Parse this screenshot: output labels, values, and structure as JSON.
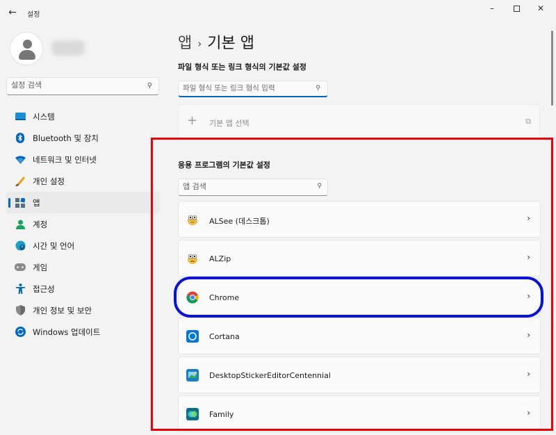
{
  "window": {
    "title": "설정",
    "back_icon": "←",
    "minimize_icon": "–",
    "close_icon": "✕"
  },
  "sidebar": {
    "search_placeholder": "설정 검색",
    "items": [
      {
        "label": "시스템",
        "icon": "monitor-icon",
        "color": "#0078d4"
      },
      {
        "label": "Bluetooth 및 장치",
        "icon": "bluetooth-icon",
        "color": "#0067c0"
      },
      {
        "label": "네트워크 및 인터넷",
        "icon": "wifi-icon",
        "color": "#0067c0"
      },
      {
        "label": "개인 설정",
        "icon": "brush-icon",
        "color": "#e3a21a"
      },
      {
        "label": "앱",
        "icon": "apps-icon",
        "color": "#0067c0",
        "active": true
      },
      {
        "label": "계정",
        "icon": "account-icon",
        "color": "#1aa260"
      },
      {
        "label": "시간 및 언어",
        "icon": "globe-clock-icon",
        "color": "#1aa0c8"
      },
      {
        "label": "게임",
        "icon": "gamepad-icon",
        "color": "#777777"
      },
      {
        "label": "접근성",
        "icon": "accessibility-icon",
        "color": "#0067c0"
      },
      {
        "label": "개인 정보 및 보안",
        "icon": "shield-icon",
        "color": "#888888"
      },
      {
        "label": "Windows 업데이트",
        "icon": "update-icon",
        "color": "#0067c0"
      }
    ]
  },
  "main": {
    "breadcrumb_parent": "앱",
    "breadcrumb_sep": "›",
    "breadcrumb_current": "기본 앱",
    "filetype_heading": "파일 형식 또는 링크 형식의 기본값 설정",
    "filetype_placeholder": "파일 형식 또는 링크 형식 입력",
    "choose_default_label": "기본 앱 선택",
    "apps_heading": "응용 프로그램의 기본값 설정",
    "app_search_placeholder": "앱 검색",
    "apps": [
      {
        "name": "ALSee (데스크톱)",
        "icon": "alsee-icon"
      },
      {
        "name": "ALZip",
        "icon": "alzip-icon"
      },
      {
        "name": "Chrome",
        "icon": "chrome-icon"
      },
      {
        "name": "Cortana",
        "icon": "cortana-icon"
      },
      {
        "name": "DesktopStickerEditorCentennial",
        "icon": "sticker-editor-icon"
      },
      {
        "name": "Family",
        "icon": "family-icon"
      }
    ]
  },
  "colors": {
    "accent": "#0067c0",
    "highlight_red": "#e8000b",
    "highlight_blue": "#0a12d6"
  }
}
